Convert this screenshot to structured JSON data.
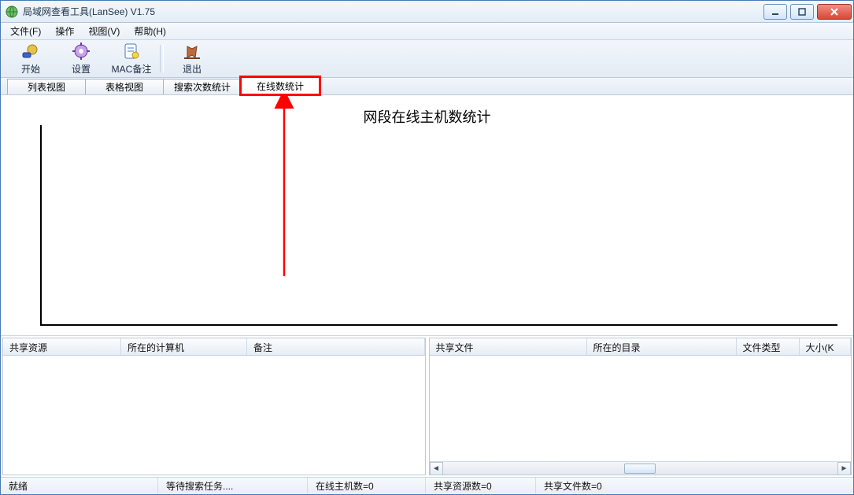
{
  "window": {
    "title": "局域网查看工具(LanSee) V1.75",
    "controls": {
      "min": "min",
      "max": "max",
      "close": "close"
    }
  },
  "menu": {
    "file": "文件(F)",
    "operate": "操作",
    "view": "视图(V)",
    "help": "帮助(H)"
  },
  "toolbar": {
    "start": "开始",
    "settings": "设置",
    "mac_remark": "MAC备注",
    "exit": "退出"
  },
  "tabs": {
    "list_view": "列表视图",
    "table_view": "表格视图",
    "search_count_stats": "搜索次数统计",
    "online_count_stats": "在线数统计",
    "active_index": 3
  },
  "chart_data": {
    "type": "bar",
    "title": "网段在线主机数统计",
    "xlabel": "",
    "ylabel": "",
    "categories": [],
    "values": [],
    "ylim": [
      0,
      10
    ]
  },
  "left_panel": {
    "columns": {
      "shared_resource": "共享资源",
      "host_computer": "所在的计算机",
      "remark": "备注"
    },
    "rows": []
  },
  "right_panel": {
    "columns": {
      "shared_file": "共享文件",
      "directory": "所在的目录",
      "file_type": "文件类型",
      "size": "大小(K"
    },
    "rows": []
  },
  "status": {
    "ready": "就绪",
    "waiting": "等待搜索任务....",
    "online_hosts": "在线主机数=0",
    "shared_resources": "共享资源数=0",
    "shared_files": "共享文件数=0"
  },
  "annotation": {
    "color": "#ff0000",
    "target_tab": "在线数统计"
  }
}
